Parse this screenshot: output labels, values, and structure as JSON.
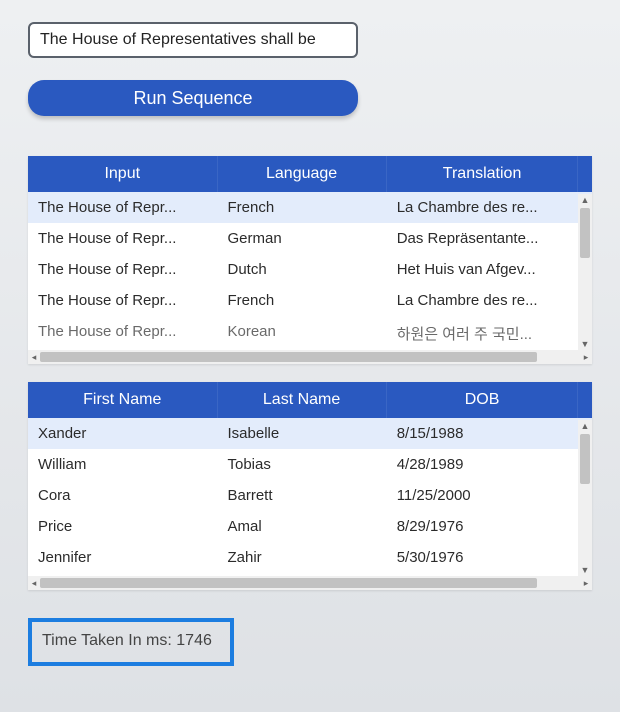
{
  "input_field": {
    "value": "The House of Representatives shall be"
  },
  "run_button": {
    "label": "Run Sequence"
  },
  "table1": {
    "headers": {
      "col1": "Input",
      "col2": "Language",
      "col3": "Translation"
    },
    "rows": [
      {
        "input": "The House of Repr...",
        "language": "French",
        "translation": "La Chambre des re..."
      },
      {
        "input": "The House of Repr...",
        "language": "German",
        "translation": "Das Repräsentante..."
      },
      {
        "input": "The House of Repr...",
        "language": "Dutch",
        "translation": "Het Huis van Afgev..."
      },
      {
        "input": "The House of Repr...",
        "language": "French",
        "translation": "La Chambre des re..."
      },
      {
        "input": "The House of Repr...",
        "language": "Korean",
        "translation": "하원은 여러 주 국민..."
      }
    ]
  },
  "table2": {
    "headers": {
      "col1": "First Name",
      "col2": "Last Name",
      "col3": "DOB"
    },
    "rows": [
      {
        "first": "Xander",
        "last": "Isabelle",
        "dob": "8/15/1988"
      },
      {
        "first": "William",
        "last": "Tobias",
        "dob": "4/28/1989"
      },
      {
        "first": "Cora",
        "last": "Barrett",
        "dob": "11/25/2000"
      },
      {
        "first": "Price",
        "last": "Amal",
        "dob": "8/29/1976"
      },
      {
        "first": "Jennifer",
        "last": "Zahir",
        "dob": "5/30/1976"
      }
    ]
  },
  "status": {
    "label": "Time Taken In ms:",
    "value": "1746"
  }
}
